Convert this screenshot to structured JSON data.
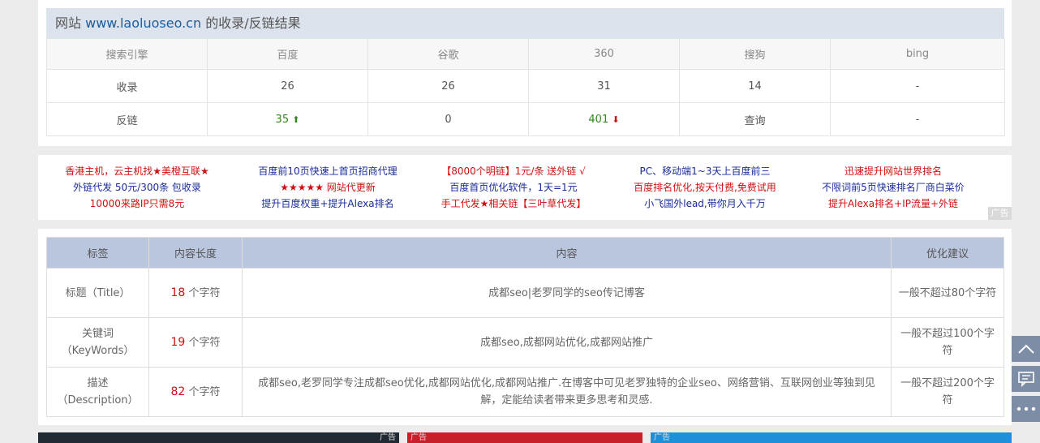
{
  "result_panel": {
    "title_prefix": "网站",
    "site": "www.laoluoseo.cn",
    "title_suffix": "的收录/反链结果",
    "headers": [
      "搜索引擎",
      "百度",
      "谷歌",
      "360",
      "搜狗",
      "bing"
    ],
    "rows": [
      {
        "label": "收录",
        "cells": [
          "26",
          "26",
          "31",
          "14",
          "-"
        ]
      },
      {
        "label": "反链",
        "cells": [
          "35",
          "0",
          "401",
          "查询",
          "-"
        ]
      }
    ],
    "arrow_up": "⬆",
    "arrow_down": "⬇"
  },
  "ads": {
    "tag": "广告",
    "columns": [
      [
        "香港主机，云主机找★美橙互联★",
        "外链代发 50元/300条 包收录",
        "10000来路IP只需8元"
      ],
      [
        "百度前10页快速上首页招商代理",
        "★★★★★ 网站代更新",
        "提升百度权重+提升Alexa排名"
      ],
      [
        "【8000个明链】1元/条 送外链 √",
        "百度首页优化软件，1天=1元",
        "手工代发★相关链【三叶草代发】"
      ],
      [
        "PC、移动端1~3天上百度前三",
        "百度排名优化,按天付费,免费试用",
        "小飞国外lead,带你月入千万"
      ],
      [
        "迅速提升网站世界排名",
        "不限词前5页快速排名厂商白菜价",
        "提升Alexa排名+IP流量+外链"
      ]
    ]
  },
  "meta_table": {
    "headers": [
      "标签",
      "内容长度",
      "内容",
      "优化建议"
    ],
    "unit": "个字符",
    "rows": [
      {
        "tag": "标题（Title）",
        "length": "18",
        "content": "成都seo|老罗同学的seo传记博客",
        "advice": "一般不超过80个字符"
      },
      {
        "tag": "关键词（KeyWords）",
        "length": "19",
        "content": "成都seo,成都网站优化,成都网站推广",
        "advice": "一般不超过100个字符"
      },
      {
        "tag": "描述（Description）",
        "length": "82",
        "content": "成都seo,老罗同学专注成都seo优化,成都网站优化,成都网站推广.在博客中可见老罗独特的企业seo、网络营销、互联网创业等独到见解，定能给读者带来更多思考和灵感.",
        "advice": "一般不超过200个字符"
      }
    ]
  },
  "bottom_ads": {
    "tag": "广告"
  },
  "side_buttons": [
    "back-to-top-icon",
    "feedback-icon",
    "more-icon"
  ]
}
